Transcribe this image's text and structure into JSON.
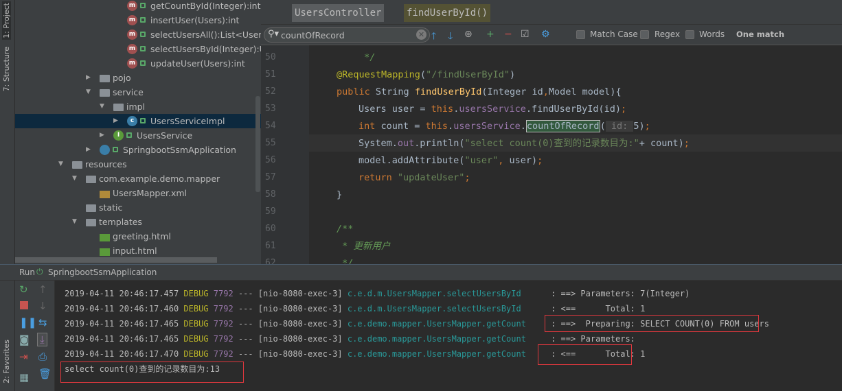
{
  "sidebar_tabs": {
    "project": "1: Project",
    "structure": "7: Structure",
    "favorites": "2: Favorites"
  },
  "tree": [
    {
      "label": "getCountById(Integer):int",
      "icon": "method-icon",
      "indent": 185,
      "lock": true
    },
    {
      "label": "insertUser(Users):int",
      "icon": "method-icon",
      "indent": 185,
      "lock": true
    },
    {
      "label": "selectUsersAll():List<Users>",
      "icon": "method-icon",
      "indent": 185,
      "lock": true
    },
    {
      "label": "selectUsersById(Integer):Users",
      "icon": "method-icon",
      "indent": 185,
      "lock": true
    },
    {
      "label": "updateUser(Users):int",
      "icon": "method-icon",
      "indent": 185,
      "lock": true
    },
    {
      "label": "pojo",
      "icon": "folder-icon",
      "indent": 145,
      "arrow": "right"
    },
    {
      "label": "service",
      "icon": "folder-icon",
      "indent": 145,
      "arrow": "down"
    },
    {
      "label": "impl",
      "icon": "folder-icon",
      "indent": 165,
      "arrow": "down"
    },
    {
      "label": "UsersServiceImpl",
      "icon": "class-icon",
      "indent": 185,
      "arrow": "right",
      "lock": true,
      "selected": true
    },
    {
      "label": "UsersService",
      "icon": "interface-icon",
      "indent": 165,
      "arrow": "right",
      "lock": true
    },
    {
      "label": "SpringbootSsmApplication",
      "icon": "spring-app-icon",
      "indent": 145,
      "arrow": "right",
      "lock": true
    },
    {
      "label": "resources",
      "icon": "resources-folder-icon",
      "indent": 105,
      "arrow": "down"
    },
    {
      "label": "com.example.demo.mapper",
      "icon": "folder-icon",
      "indent": 125,
      "arrow": "down"
    },
    {
      "label": "UsersMapper.xml",
      "icon": "xml-file-icon",
      "indent": 145
    },
    {
      "label": "static",
      "icon": "folder-icon",
      "indent": 125
    },
    {
      "label": "templates",
      "icon": "folder-icon",
      "indent": 125,
      "arrow": "down"
    },
    {
      "label": "greeting.html",
      "icon": "html-file-icon",
      "indent": 145
    },
    {
      "label": "input.html",
      "icon": "html-file-icon",
      "indent": 145
    }
  ],
  "breadcrumbs": [
    "UsersController",
    "findUserById()"
  ],
  "search": {
    "value": "countOfRecord",
    "match_case": "Match Case",
    "regex": "Regex",
    "words": "Words",
    "status": "One match"
  },
  "code": [
    {
      "n": "50",
      "indent": 1,
      "seg": [
        [
          " */",
          "c"
        ]
      ]
    },
    {
      "n": "51",
      "indent": 0,
      "seg": [
        [
          "@RequestMapping",
          "a"
        ],
        [
          "(",
          ""
        ],
        [
          "\"/findUserById\"",
          "s"
        ],
        [
          ")",
          ""
        ]
      ]
    },
    {
      "n": "52",
      "indent": 0,
      "seg": [
        [
          "public ",
          "k"
        ],
        [
          "String ",
          ""
        ],
        [
          "findUserById",
          "m"
        ],
        [
          "(Integer id",
          ""
        ],
        [
          ",",
          "k"
        ],
        [
          "Model model){",
          ""
        ]
      ]
    },
    {
      "n": "53",
      "indent": 1,
      "seg": [
        [
          "Users user = ",
          ""
        ],
        [
          "this",
          "k"
        ],
        [
          ".",
          ""
        ],
        [
          "usersService",
          "f"
        ],
        [
          ".findUserById(id)",
          ""
        ],
        [
          ";",
          "k"
        ]
      ]
    },
    {
      "n": "54",
      "indent": 1,
      "seg": [
        [
          "int ",
          "k"
        ],
        [
          "count = ",
          ""
        ],
        [
          "this",
          "k"
        ],
        [
          ".",
          ""
        ],
        [
          "usersService",
          "f"
        ],
        [
          ".",
          ""
        ],
        [
          "countOfRecord",
          "h"
        ],
        [
          "(",
          ""
        ],
        [
          " id: ",
          "hint"
        ],
        [
          "5)",
          ""
        ],
        [
          ";",
          "k"
        ]
      ]
    },
    {
      "n": "55",
      "indent": 1,
      "seg": [
        [
          "System.",
          ""
        ],
        [
          "out",
          "f"
        ],
        [
          ".println(",
          ""
        ],
        [
          "\"select count(0)查到的记录数目为:\"",
          "s"
        ],
        [
          "+ count)",
          ""
        ],
        [
          ";",
          "k"
        ]
      ]
    },
    {
      "n": "56",
      "indent": 1,
      "seg": [
        [
          "model.addAttribute(",
          ""
        ],
        [
          "\"user\"",
          "s"
        ],
        [
          ", ",
          "k"
        ],
        [
          "user)",
          ""
        ],
        [
          ";",
          "k"
        ]
      ]
    },
    {
      "n": "57",
      "indent": 1,
      "seg": [
        [
          "return ",
          "k"
        ],
        [
          "\"updateUser\"",
          "s"
        ],
        [
          ";",
          "k"
        ]
      ]
    },
    {
      "n": "58",
      "indent": 0,
      "seg": [
        [
          "}",
          ""
        ]
      ]
    },
    {
      "n": "59",
      "indent": 0,
      "seg": []
    },
    {
      "n": "60",
      "indent": 0,
      "seg": [
        [
          "/**",
          "c"
        ]
      ]
    },
    {
      "n": "61",
      "indent": 0,
      "seg": [
        [
          " * 更新用户",
          "c"
        ]
      ]
    },
    {
      "n": "62",
      "indent": 0,
      "seg": [
        [
          " */",
          "c"
        ]
      ]
    }
  ],
  "run": {
    "label": "Run",
    "config": "SpringbootSsmApplication"
  },
  "console": [
    {
      "date": "2019-04-11 20:46:17.457",
      "level": "DEBUG",
      "pid": "7792",
      "thread": "--- [nio-8080-exec-3]",
      "logger": "c.e.d.m.UsersMapper.selectUsersById     ",
      "msg": ": ==> Parameters: 7(Integer)"
    },
    {
      "date": "2019-04-11 20:46:17.460",
      "level": "DEBUG",
      "pid": "7792",
      "thread": "--- [nio-8080-exec-3]",
      "logger": "c.e.d.m.UsersMapper.selectUsersById     ",
      "msg": ": <==      Total: 1"
    },
    {
      "date": "2019-04-11 20:46:17.465",
      "level": "DEBUG",
      "pid": "7792",
      "thread": "--- [nio-8080-exec-3]",
      "logger": "c.e.demo.mapper.UsersMapper.getCount    ",
      "msg": ": ==>  Preparing: SELECT COUNT(0) FROM users"
    },
    {
      "date": "2019-04-11 20:46:17.465",
      "level": "DEBUG",
      "pid": "7792",
      "thread": "--- [nio-8080-exec-3]",
      "logger": "c.e.demo.mapper.UsersMapper.getCount    ",
      "msg": ": ==> Parameters: "
    },
    {
      "date": "2019-04-11 20:46:17.470",
      "level": "DEBUG",
      "pid": "7792",
      "thread": "--- [nio-8080-exec-3]",
      "logger": "c.e.demo.mapper.UsersMapper.getCount    ",
      "msg": ": <==      Total: 1"
    }
  ],
  "console_output": "select count(0)查到的记录数目为:13",
  "colors": {
    "keyword": "#cc7832",
    "string": "#6a8759",
    "field": "#9876aa",
    "annotation": "#bbb529",
    "highlight_box": "#e0383e",
    "selection": "#0d293e"
  }
}
